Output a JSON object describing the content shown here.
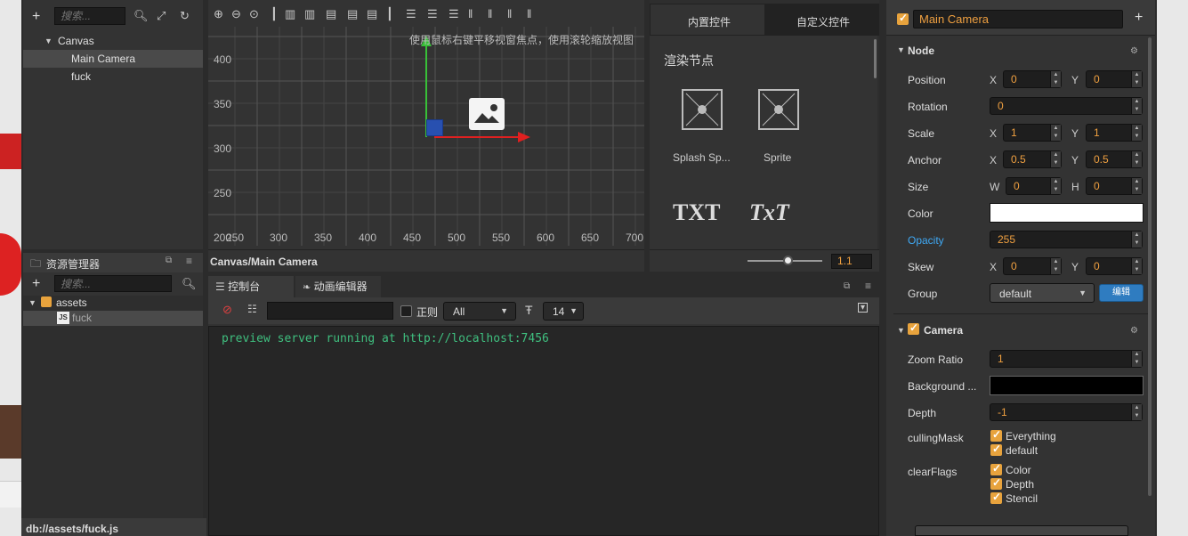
{
  "hierarchy": {
    "search_placeholder": "搜索...",
    "items": [
      {
        "label": "Canvas"
      },
      {
        "label": "Main Camera"
      },
      {
        "label": "fuck"
      }
    ]
  },
  "assets": {
    "title": "资源管理器",
    "search_placeholder": "搜索...",
    "items": [
      {
        "label": "assets"
      },
      {
        "label": "fuck"
      }
    ],
    "status_path": "db://assets/fuck.js"
  },
  "scene": {
    "hint": "使用鼠标右键平移视窗焦点，使用滚轮缩放视图",
    "y_labels": [
      "400",
      "350",
      "300",
      "250",
      "200"
    ],
    "x_labels": [
      "250",
      "300",
      "350",
      "400",
      "450",
      "500",
      "550",
      "600",
      "650",
      "700"
    ],
    "breadcrumb": "Canvas/Main Camera"
  },
  "widgets": {
    "tabs": [
      "内置控件",
      "自定义控件"
    ],
    "section_title": "渲染节点",
    "items": [
      {
        "label": "Splash Sp...",
        "icon": "splash-sprite-icon"
      },
      {
        "label": "Sprite",
        "icon": "sprite-icon"
      }
    ],
    "text_icons": [
      "TXT",
      "TxT"
    ],
    "zoom_value": "1.1"
  },
  "console": {
    "tabs": [
      "控制台",
      "动画编辑器"
    ],
    "regex_label": "正则",
    "filter_value": "All",
    "font_size": "14",
    "log_line": "preview server running at http://localhost:7456"
  },
  "inspector": {
    "node_name": "Main Camera",
    "node_section": "Node",
    "props": {
      "position": {
        "label": "Position",
        "x": "0",
        "y": "0"
      },
      "rotation": {
        "label": "Rotation",
        "value": "0"
      },
      "scale": {
        "label": "Scale",
        "x": "1",
        "y": "1"
      },
      "anchor": {
        "label": "Anchor",
        "x": "0.5",
        "y": "0.5"
      },
      "size": {
        "label": "Size",
        "w": "0",
        "h": "0"
      },
      "color": {
        "label": "Color"
      },
      "opacity": {
        "label": "Opacity",
        "value": "255"
      },
      "skew": {
        "label": "Skew",
        "x": "0",
        "y": "0"
      },
      "group": {
        "label": "Group",
        "value": "default",
        "edit_label": "编辑"
      }
    },
    "camera_section": "Camera",
    "camera": {
      "zoom_ratio": {
        "label": "Zoom Ratio",
        "value": "1"
      },
      "background": {
        "label": "Background ..."
      },
      "depth": {
        "label": "Depth",
        "value": "-1"
      },
      "culling_mask": {
        "label": "cullingMask",
        "options": [
          "Everything",
          "default"
        ]
      },
      "clear_flags": {
        "label": "clearFlags",
        "options": [
          "Color",
          "Depth",
          "Stencil"
        ]
      }
    },
    "axis_labels": {
      "x": "X",
      "y": "Y",
      "w": "W",
      "h": "H"
    }
  },
  "colors": {
    "accent_orange": "#e8a33d",
    "console_green": "#3fbf7f",
    "link_blue": "#3fa9f5",
    "edit_button": "#2f7cc0"
  }
}
